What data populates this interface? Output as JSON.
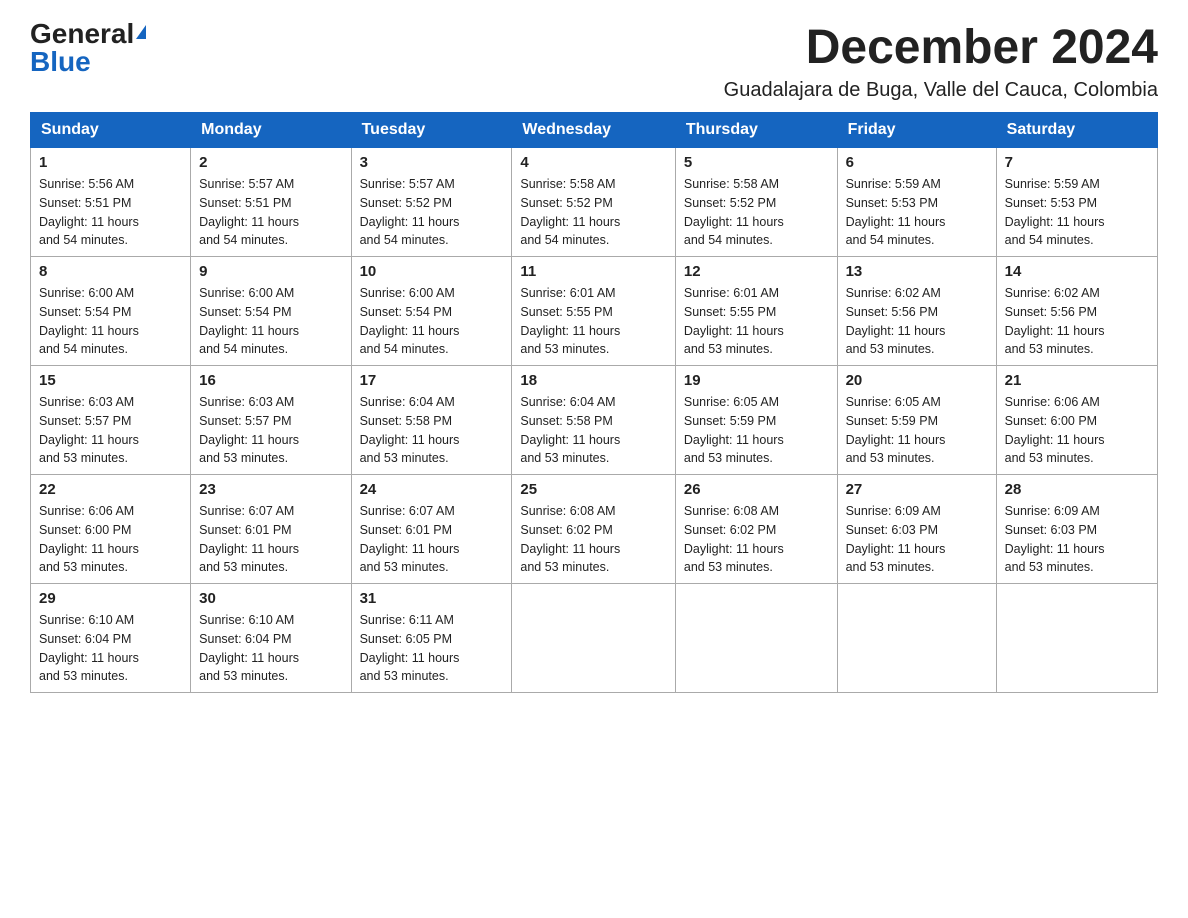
{
  "logo": {
    "general": "General",
    "blue": "Blue"
  },
  "title": "December 2024",
  "subtitle": "Guadalajara de Buga, Valle del Cauca, Colombia",
  "days_of_week": [
    "Sunday",
    "Monday",
    "Tuesday",
    "Wednesday",
    "Thursday",
    "Friday",
    "Saturday"
  ],
  "weeks": [
    [
      {
        "day": "1",
        "sunrise": "5:56 AM",
        "sunset": "5:51 PM",
        "daylight": "11 hours and 54 minutes."
      },
      {
        "day": "2",
        "sunrise": "5:57 AM",
        "sunset": "5:51 PM",
        "daylight": "11 hours and 54 minutes."
      },
      {
        "day": "3",
        "sunrise": "5:57 AM",
        "sunset": "5:52 PM",
        "daylight": "11 hours and 54 minutes."
      },
      {
        "day": "4",
        "sunrise": "5:58 AM",
        "sunset": "5:52 PM",
        "daylight": "11 hours and 54 minutes."
      },
      {
        "day": "5",
        "sunrise": "5:58 AM",
        "sunset": "5:52 PM",
        "daylight": "11 hours and 54 minutes."
      },
      {
        "day": "6",
        "sunrise": "5:59 AM",
        "sunset": "5:53 PM",
        "daylight": "11 hours and 54 minutes."
      },
      {
        "day": "7",
        "sunrise": "5:59 AM",
        "sunset": "5:53 PM",
        "daylight": "11 hours and 54 minutes."
      }
    ],
    [
      {
        "day": "8",
        "sunrise": "6:00 AM",
        "sunset": "5:54 PM",
        "daylight": "11 hours and 54 minutes."
      },
      {
        "day": "9",
        "sunrise": "6:00 AM",
        "sunset": "5:54 PM",
        "daylight": "11 hours and 54 minutes."
      },
      {
        "day": "10",
        "sunrise": "6:00 AM",
        "sunset": "5:54 PM",
        "daylight": "11 hours and 54 minutes."
      },
      {
        "day": "11",
        "sunrise": "6:01 AM",
        "sunset": "5:55 PM",
        "daylight": "11 hours and 53 minutes."
      },
      {
        "day": "12",
        "sunrise": "6:01 AM",
        "sunset": "5:55 PM",
        "daylight": "11 hours and 53 minutes."
      },
      {
        "day": "13",
        "sunrise": "6:02 AM",
        "sunset": "5:56 PM",
        "daylight": "11 hours and 53 minutes."
      },
      {
        "day": "14",
        "sunrise": "6:02 AM",
        "sunset": "5:56 PM",
        "daylight": "11 hours and 53 minutes."
      }
    ],
    [
      {
        "day": "15",
        "sunrise": "6:03 AM",
        "sunset": "5:57 PM",
        "daylight": "11 hours and 53 minutes."
      },
      {
        "day": "16",
        "sunrise": "6:03 AM",
        "sunset": "5:57 PM",
        "daylight": "11 hours and 53 minutes."
      },
      {
        "day": "17",
        "sunrise": "6:04 AM",
        "sunset": "5:58 PM",
        "daylight": "11 hours and 53 minutes."
      },
      {
        "day": "18",
        "sunrise": "6:04 AM",
        "sunset": "5:58 PM",
        "daylight": "11 hours and 53 minutes."
      },
      {
        "day": "19",
        "sunrise": "6:05 AM",
        "sunset": "5:59 PM",
        "daylight": "11 hours and 53 minutes."
      },
      {
        "day": "20",
        "sunrise": "6:05 AM",
        "sunset": "5:59 PM",
        "daylight": "11 hours and 53 minutes."
      },
      {
        "day": "21",
        "sunrise": "6:06 AM",
        "sunset": "6:00 PM",
        "daylight": "11 hours and 53 minutes."
      }
    ],
    [
      {
        "day": "22",
        "sunrise": "6:06 AM",
        "sunset": "6:00 PM",
        "daylight": "11 hours and 53 minutes."
      },
      {
        "day": "23",
        "sunrise": "6:07 AM",
        "sunset": "6:01 PM",
        "daylight": "11 hours and 53 minutes."
      },
      {
        "day": "24",
        "sunrise": "6:07 AM",
        "sunset": "6:01 PM",
        "daylight": "11 hours and 53 minutes."
      },
      {
        "day": "25",
        "sunrise": "6:08 AM",
        "sunset": "6:02 PM",
        "daylight": "11 hours and 53 minutes."
      },
      {
        "day": "26",
        "sunrise": "6:08 AM",
        "sunset": "6:02 PM",
        "daylight": "11 hours and 53 minutes."
      },
      {
        "day": "27",
        "sunrise": "6:09 AM",
        "sunset": "6:03 PM",
        "daylight": "11 hours and 53 minutes."
      },
      {
        "day": "28",
        "sunrise": "6:09 AM",
        "sunset": "6:03 PM",
        "daylight": "11 hours and 53 minutes."
      }
    ],
    [
      {
        "day": "29",
        "sunrise": "6:10 AM",
        "sunset": "6:04 PM",
        "daylight": "11 hours and 53 minutes."
      },
      {
        "day": "30",
        "sunrise": "6:10 AM",
        "sunset": "6:04 PM",
        "daylight": "11 hours and 53 minutes."
      },
      {
        "day": "31",
        "sunrise": "6:11 AM",
        "sunset": "6:05 PM",
        "daylight": "11 hours and 53 minutes."
      },
      null,
      null,
      null,
      null
    ]
  ],
  "labels": {
    "sunrise": "Sunrise:",
    "sunset": "Sunset:",
    "daylight": "Daylight:"
  }
}
